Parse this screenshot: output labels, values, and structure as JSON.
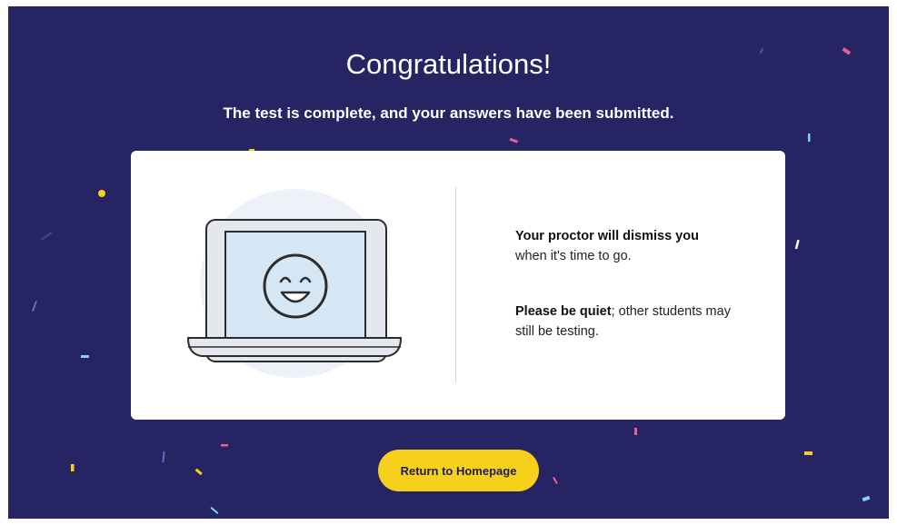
{
  "header": {
    "title": "Congratulations!",
    "subtitle": "The test is complete, and your answers have been submitted."
  },
  "card": {
    "illustration_icon": "laptop-smiley-icon",
    "message1_bold": "Your proctor will dismiss you",
    "message1_rest": "when it's time to go.",
    "message2_bold": "Please be quiet",
    "message2_rest": "; other students may still be testing."
  },
  "actions": {
    "return_label": "Return to Homepage"
  },
  "colors": {
    "background": "#272463",
    "card": "#ffffff",
    "button": "#f7d01c",
    "confetti_pink": "#ee5f8f",
    "confetti_yellow": "#f7d01c",
    "confetti_blue": "#7fd3f0"
  }
}
